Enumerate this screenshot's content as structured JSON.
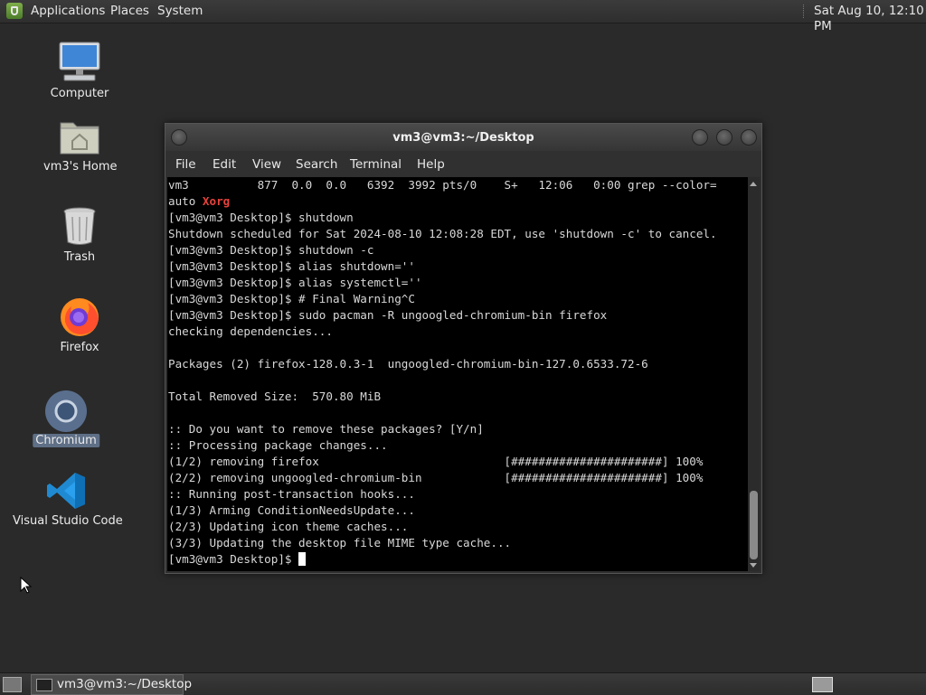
{
  "top_panel": {
    "menus": [
      "Applications",
      "Places",
      "System"
    ],
    "clock": "Sat Aug 10, 12:10 PM"
  },
  "desktop_icons": [
    {
      "label": "Computer",
      "icon": "computer-icon"
    },
    {
      "label": "vm3's Home",
      "icon": "home-folder-icon"
    },
    {
      "label": "Trash",
      "icon": "trash-icon"
    },
    {
      "label": "Firefox",
      "icon": "firefox-icon"
    },
    {
      "label": "Chromium",
      "icon": "chromium-icon",
      "selected": true
    },
    {
      "label": "Visual Studio Code",
      "icon": "vscode-icon"
    }
  ],
  "terminal": {
    "title": "vm3@vm3:~/Desktop",
    "menu": [
      "File",
      "Edit",
      "View",
      "Search",
      "Terminal",
      "Help"
    ],
    "lines": [
      "vm3          877  0.0  0.0   6392  3992 pts/0    S+   12:06   0:00 grep --color=",
      "auto ",
      "[vm3@vm3 Desktop]$ shutdown",
      "Shutdown scheduled for Sat 2024-08-10 12:08:28 EDT, use 'shutdown -c' to cancel.",
      "[vm3@vm3 Desktop]$ shutdown -c",
      "[vm3@vm3 Desktop]$ alias shutdown=''",
      "[vm3@vm3 Desktop]$ alias systemctl=''",
      "[vm3@vm3 Desktop]$ # Final Warning^C",
      "[vm3@vm3 Desktop]$ sudo pacman -R ungoogled-chromium-bin firefox",
      "checking dependencies...",
      "",
      "Packages (2) firefox-128.0.3-1  ungoogled-chromium-bin-127.0.6533.72-6",
      "",
      "Total Removed Size:  570.80 MiB",
      "",
      ":: Do you want to remove these packages? [Y/n]",
      ":: Processing package changes...",
      "(1/2) removing firefox                           [######################] 100%",
      "(2/2) removing ungoogled-chromium-bin            [######################] 100%",
      ":: Running post-transaction hooks...",
      "(1/3) Arming ConditionNeedsUpdate...",
      "(2/3) Updating icon theme caches...",
      "(3/3) Updating the desktop file MIME type cache...",
      "[vm3@vm3 Desktop]$ "
    ],
    "highlight_word": "Xorg",
    "scrollbar_position": 0.84
  },
  "bottom_panel": {
    "task_label": "vm3@vm3:~/Desktop"
  },
  "colors": {
    "highlight_red": "#e8423c",
    "selection": "#5e6f86"
  }
}
